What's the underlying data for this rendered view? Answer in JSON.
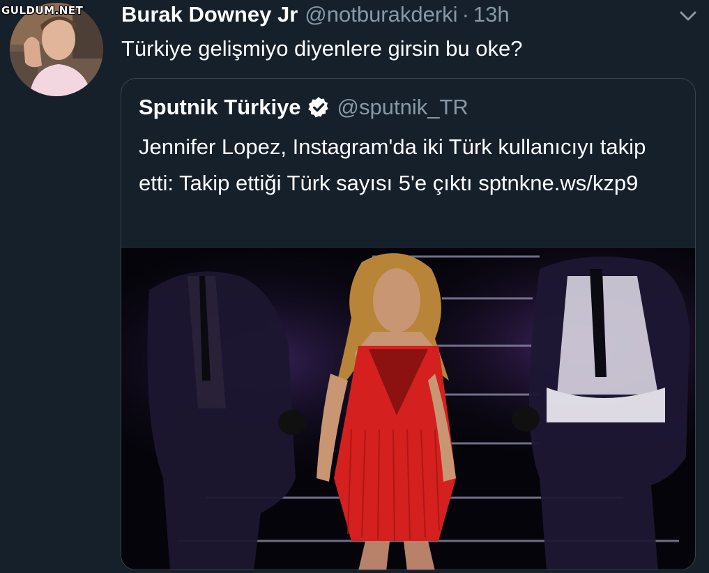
{
  "watermark": "GULDUM.NET",
  "tweet": {
    "display_name": "Burak Downey Jr",
    "handle": "@notburakderki",
    "separator": "·",
    "time": "13h",
    "text": "Türkiye gelişmiyo diyenlere girsin bu oke?"
  },
  "quoted_tweet": {
    "display_name": "Sputnik Türkiye",
    "verified": true,
    "handle": "@sputnik_TR",
    "text": "Jennifer Lopez, Instagram'da iki Türk kullanıcıyı takip etti: Takip ettiği Türk sayısı 5'e çıktı sptnkne.ws/kzp9"
  },
  "icons": {
    "menu": "chevron-down-icon",
    "verified": "verified-badge-icon"
  },
  "colors": {
    "background": "#15202b",
    "primary_text": "#ffffff",
    "secondary_text": "#8899a6",
    "border": "#38444d",
    "dress_red": "#d4201e"
  }
}
